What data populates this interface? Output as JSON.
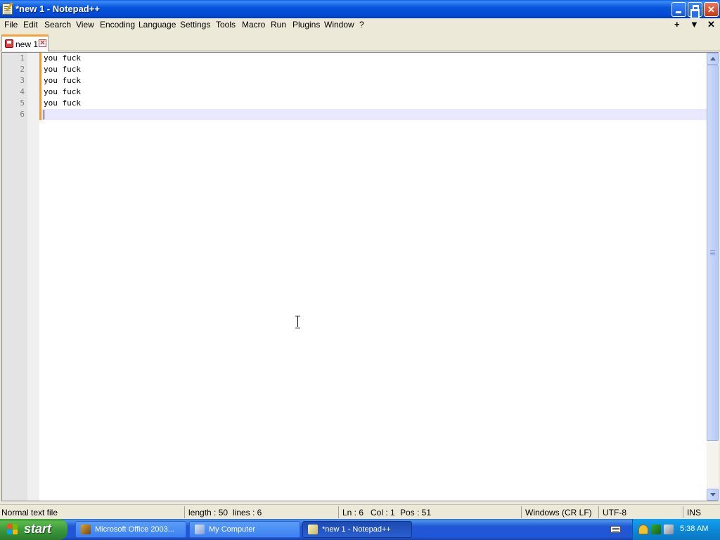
{
  "window": {
    "title": "*new 1 - Notepad++",
    "controls": {
      "minimize": "minimize",
      "maximize": "restore",
      "close": "close"
    }
  },
  "menubar": {
    "items": [
      "File",
      "Edit",
      "Search",
      "View",
      "Encoding",
      "Language",
      "Settings",
      "Tools",
      "Macro",
      "Run",
      "Plugins",
      "Window",
      "?"
    ],
    "right_controls": [
      "+",
      "▼",
      "✕"
    ]
  },
  "tabs": [
    {
      "label": "new 1",
      "close": "✕",
      "icon": "unsaved-file-icon",
      "active": true
    }
  ],
  "editor": {
    "line_numbers": [
      "1",
      "2",
      "3",
      "4",
      "5",
      "6"
    ],
    "lines": [
      "you fuck",
      "you fuck",
      "you fuck",
      "you fuck",
      "you fuck",
      ""
    ],
    "current_line": 6,
    "colors": {
      "change_bar": "#f39a2e",
      "current_line_bg": "#e8e8ff",
      "gutter_bg": "#e4e4e4"
    }
  },
  "statusbar": {
    "file_type": "Normal text file",
    "length": "length : 50",
    "lines": "lines : 6",
    "ln": "Ln : 6",
    "col": "Col : 1",
    "pos": "Pos : 51",
    "eol": "Windows (CR LF)",
    "encoding": "UTF-8",
    "mode": "INS"
  },
  "taskbar": {
    "start_label": "start",
    "tasks": [
      {
        "label": "Microsoft Office 2003...",
        "icon": "office-icon",
        "active": false
      },
      {
        "label": "My Computer",
        "icon": "my-computer-icon",
        "active": false
      },
      {
        "label": "*new 1 - Notepad++",
        "icon": "notepad-plus-plus-icon",
        "active": true
      }
    ],
    "clock": "5:38 AM",
    "tray_icons": [
      "security-shield-icon",
      "network-icon",
      "volume-icon"
    ]
  }
}
